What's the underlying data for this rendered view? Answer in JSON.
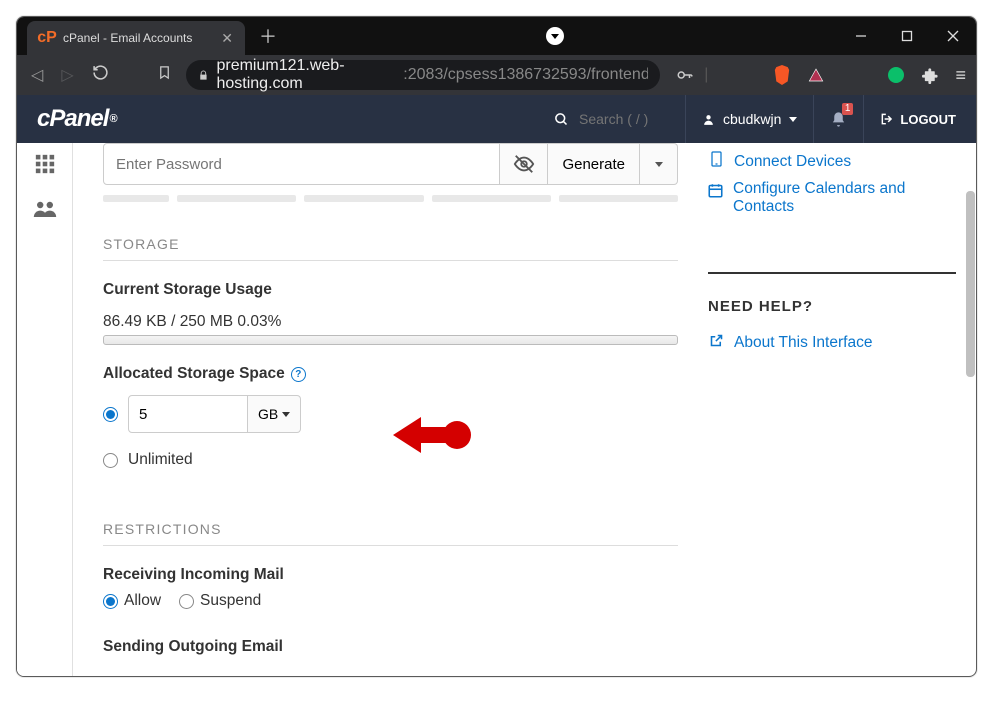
{
  "browser": {
    "tab_title": "cPanel - Email Accounts",
    "url_host": "premium121.web-hosting.com",
    "url_path": ":2083/cpsess1386732593/frontend/pap…"
  },
  "cpanel": {
    "logo": "cPanel",
    "search_placeholder": "Search ( / )",
    "username": "cbudkwjn",
    "notifications": "1",
    "logout": "LOGOUT"
  },
  "password": {
    "placeholder": "Enter Password",
    "generate": "Generate"
  },
  "sections": {
    "storage_title": "STORAGE",
    "current_usage_label": "Current Storage Usage",
    "current_usage_value": "86.49 KB / 250 MB 0.03%",
    "allocated_label": "Allocated Storage Space",
    "allocated_value": "5",
    "allocated_unit": "GB",
    "unlimited_label": "Unlimited",
    "restrictions_title": "RESTRICTIONS",
    "receiving_label": "Receiving Incoming Mail",
    "allow": "Allow",
    "suspend": "Suspend",
    "sending_label": "Sending Outgoing Email"
  },
  "right": {
    "connect_devices": "Connect Devices",
    "configure_cal": "Configure Calendars and Contacts",
    "need_help": "NEED HELP?",
    "about_interface": "About This Interface"
  }
}
